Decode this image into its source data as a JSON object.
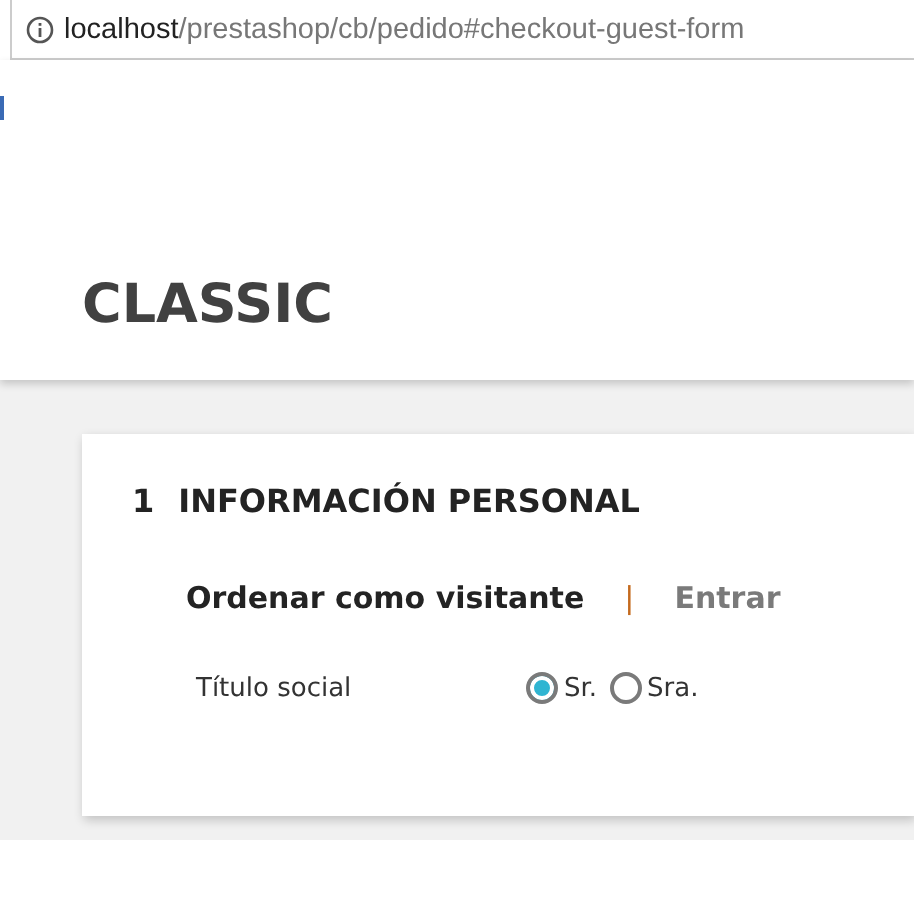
{
  "address_bar": {
    "host": "localhost",
    "path": "/prestashop/cb/pedido#checkout-guest-form"
  },
  "header": {
    "logo": "CLASSIC"
  },
  "step": {
    "number": "1",
    "title": "INFORMACIÓN PERSONAL",
    "tabs": [
      {
        "label": "Ordenar como visitante",
        "selected": true
      },
      {
        "label": "Entrar",
        "selected": false
      }
    ],
    "tab_separator": "|",
    "social_title": {
      "label": "Título social",
      "options": [
        {
          "label": "Sr.",
          "selected": true
        },
        {
          "label": "Sra.",
          "selected": false
        }
      ]
    }
  }
}
